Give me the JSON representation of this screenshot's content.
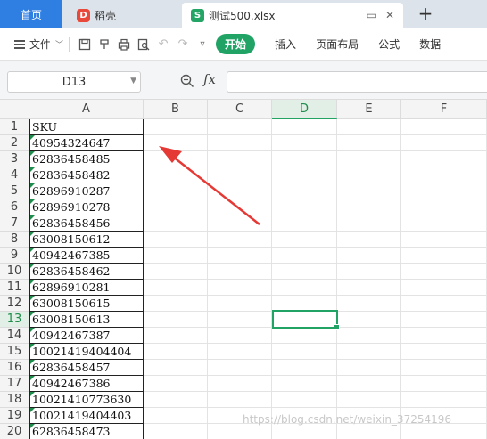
{
  "titlebar": {
    "home_tab": "首页",
    "daoke_tab": "稻壳",
    "file_tab": "测试500.xlsx",
    "new_tab": "+"
  },
  "menubar": {
    "file": "文件",
    "start": "开始",
    "items": [
      "插入",
      "页面布局",
      "公式",
      "数据"
    ]
  },
  "formulabar": {
    "namebox": "D13",
    "fx": "fx",
    "formula": ""
  },
  "sheet": {
    "columns": [
      "A",
      "B",
      "C",
      "D",
      "E",
      "F"
    ],
    "active_column": "D",
    "active_row": 13,
    "rows": [
      {
        "n": "1",
        "a": "SKU"
      },
      {
        "n": "2",
        "a": "40954324647"
      },
      {
        "n": "3",
        "a": "62836458485"
      },
      {
        "n": "4",
        "a": "62836458482"
      },
      {
        "n": "5",
        "a": "62896910287"
      },
      {
        "n": "6",
        "a": "62896910278"
      },
      {
        "n": "7",
        "a": "62836458456"
      },
      {
        "n": "8",
        "a": "63008150612"
      },
      {
        "n": "9",
        "a": "40942467385"
      },
      {
        "n": "10",
        "a": "62836458462"
      },
      {
        "n": "11",
        "a": "62896910281"
      },
      {
        "n": "12",
        "a": "63008150615"
      },
      {
        "n": "13",
        "a": "63008150613"
      },
      {
        "n": "14",
        "a": "40942467387"
      },
      {
        "n": "15",
        "a": "10021419404404"
      },
      {
        "n": "16",
        "a": "62836458457"
      },
      {
        "n": "17",
        "a": "40942467386"
      },
      {
        "n": "18",
        "a": "10021410773630"
      },
      {
        "n": "19",
        "a": "10021419404403"
      },
      {
        "n": "20",
        "a": "62836458473"
      }
    ]
  },
  "watermark": "https://blog.csdn.net/weixin_37254196",
  "colors": {
    "accent_green": "#21a366",
    "home_tab_blue": "#2f7fe3",
    "annotation_arrow": "#e53935"
  }
}
